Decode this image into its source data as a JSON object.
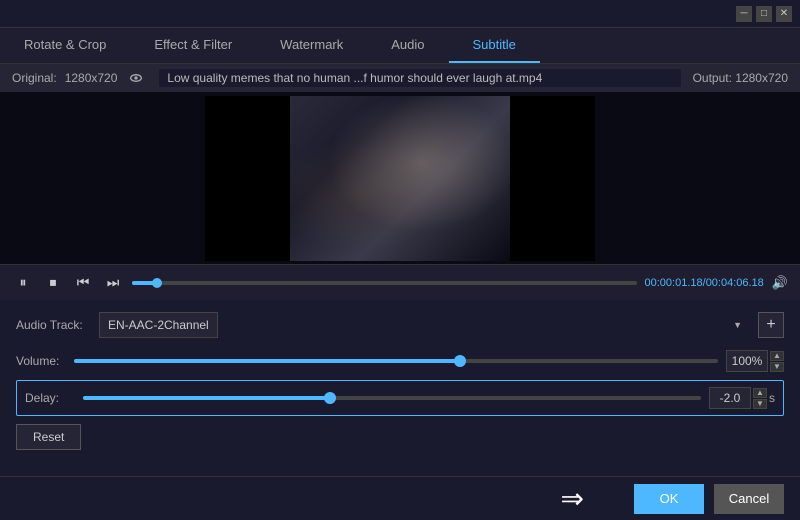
{
  "titlebar": {
    "minimize_label": "─",
    "maximize_label": "□",
    "close_label": "✕"
  },
  "tabs": [
    {
      "id": "rotate-crop",
      "label": "Rotate & Crop"
    },
    {
      "id": "effect-filter",
      "label": "Effect & Filter"
    },
    {
      "id": "watermark",
      "label": "Watermark"
    },
    {
      "id": "audio",
      "label": "Audio"
    },
    {
      "id": "subtitle",
      "label": "Subtitle"
    }
  ],
  "active_tab": "audio",
  "preview": {
    "original_label": "Original:",
    "original_res": "1280x720",
    "filename": "Low quality memes that no human ...f humor should ever laugh at.mp4",
    "output_label": "Output: 1280x720"
  },
  "controls": {
    "current_time": "00:00:01.18",
    "total_time": "00:04:06.18"
  },
  "audio": {
    "track_label": "Audio Track:",
    "track_value": "EN-AAC-2Channel",
    "add_label": "+",
    "volume_label": "Volume:",
    "volume_value": "100%",
    "volume_percent": 60,
    "delay_label": "Delay:",
    "delay_value": "-2.0",
    "delay_percent": 40,
    "delay_unit": "s",
    "reset_label": "Reset"
  },
  "footer": {
    "ok_label": "OK",
    "cancel_label": "Cancel"
  }
}
